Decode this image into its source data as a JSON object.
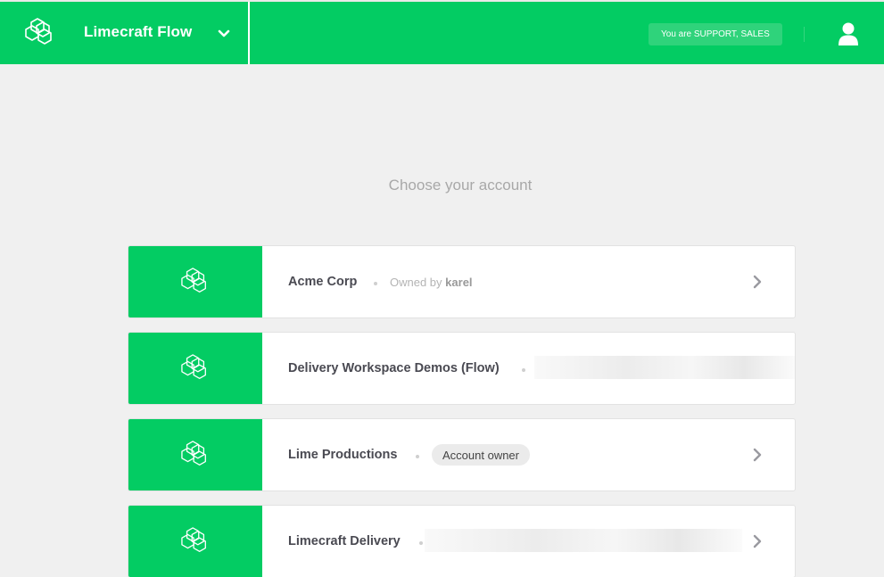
{
  "header": {
    "workspace_name": "Limecraft Flow",
    "role_badge": "You are SUPPORT, SALES",
    "logo_icon": "limecraft-logo-icon",
    "dropdown_icon": "chevron-down-icon",
    "user_icon": "user-icon"
  },
  "main": {
    "heading": "Choose your account"
  },
  "accounts": [
    {
      "name": "Acme Corp",
      "owned_by_prefix": "Owned by",
      "owner": "karel"
    },
    {
      "name": "Delivery Workspace Demos (Flow)"
    },
    {
      "name": "Lime Productions",
      "badge": "Account owner"
    },
    {
      "name": "Limecraft Delivery"
    }
  ],
  "colors": {
    "brand_green": "#03cc63",
    "background": "#f0f0f0",
    "card": "#ffffff"
  }
}
